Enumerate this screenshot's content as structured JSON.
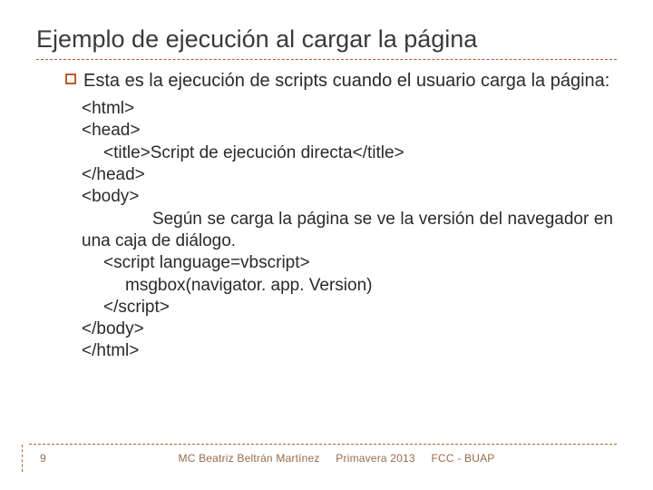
{
  "title": "Ejemplo de ejecución al cargar la página",
  "bullet": "Esta es la ejecución de scripts cuando el usuario carga la página:",
  "code": {
    "l1": "<html>",
    "l2": "<head>",
    "l3": "<title>Script de ejecución directa</title>",
    "l4": "</head>",
    "l5": "<body>",
    "l6": "Según se carga la página se ve la versión del navegador en una caja de diálogo.",
    "l7": "<script language=vbscript>",
    "l8": "msgbox(navigator. app. Version)",
    "l9": "</scr",
    "l9b": "ipt>",
    "l10": "</body>",
    "l11": "</html>"
  },
  "footer": {
    "page": "9",
    "author": "MC Beatriz Beltrán Martínez",
    "term": "Primavera 2013",
    "org": "FCC - BUAP"
  }
}
